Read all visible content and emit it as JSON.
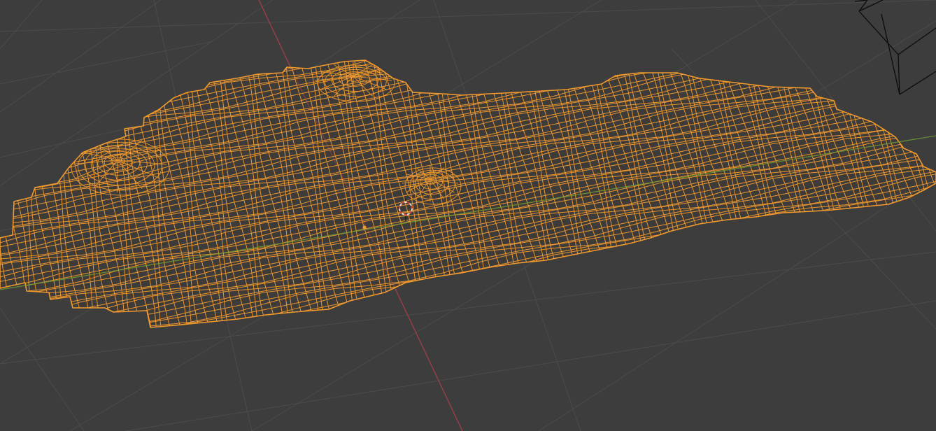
{
  "viewport": {
    "mode": "3d-viewport",
    "shading": "wireframe",
    "background_color": "#3d3d3d",
    "floor_grid_color": "#4b4b4b",
    "x_axis_color": "#9a3f4a",
    "y_axis_color": "#6f9a33"
  },
  "selected_object": {
    "type": "mesh",
    "selected": true,
    "wire_color": "#f29a2e",
    "origin_color": "#f29a2e"
  },
  "camera": {
    "wire_color": "#0b0b0b"
  },
  "cursor_3d": {
    "ring_colors": [
      "#e8d8d8",
      "#c2453f"
    ]
  },
  "icons": [
    "3d-cursor-icon",
    "object-origin-icon",
    "camera-icon"
  ]
}
